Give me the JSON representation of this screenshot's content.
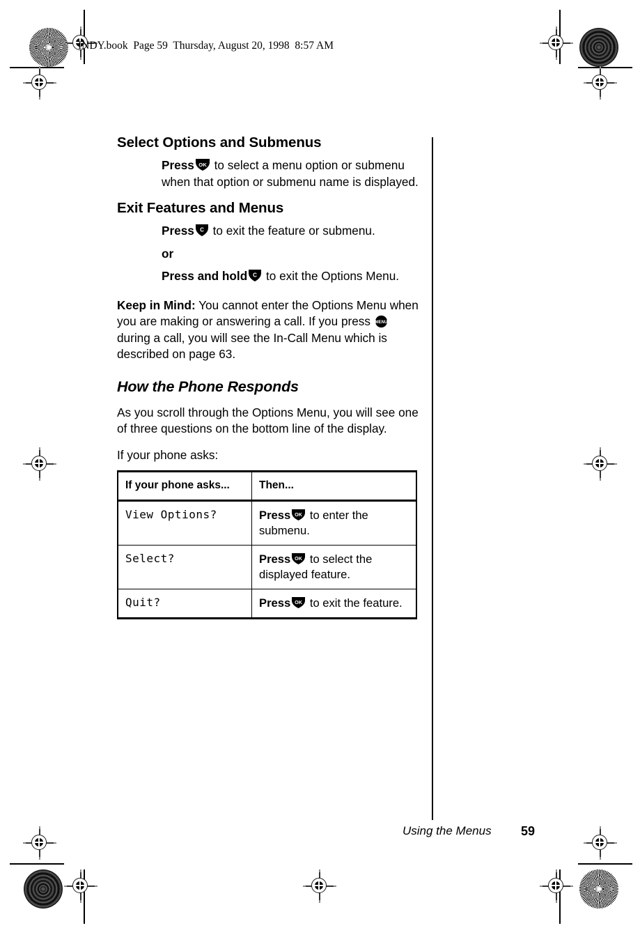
{
  "header": {
    "file_info": "INDY.book  Page 59  Thursday, August 20, 1998  8:57 AM"
  },
  "sections": [
    {
      "heading": "Select Options and Submenus",
      "paragraph_bold_lead": "Press",
      "paragraph_rest": " to select a menu option or submenu when that option or submenu name is displayed.",
      "key_icon": "ok-key-icon"
    },
    {
      "heading": "Exit Features and Menus",
      "line1_bold": "Press",
      "line1_rest": " to exit the feature or submenu.",
      "or_label": "or",
      "line2_bold": "Press and hold",
      "line2_rest": " to exit the Options Menu."
    }
  ],
  "keep_in_mind": {
    "lead": "Keep in Mind:",
    "text_part1": " You cannot enter the Options Menu when you are making or answering a call. If you press ",
    "text_part2": " during a call, you will see the In-Call Menu which is described on page 63."
  },
  "how_section": {
    "heading": "How the Phone Responds",
    "paragraph1": "As you scroll through the Options Menu, you will see one of three questions on the bottom line of the display.",
    "paragraph2": "If your phone asks:"
  },
  "table": {
    "headers": [
      "If your phone asks...",
      "Then..."
    ],
    "rows": [
      {
        "prompt": "View Options?",
        "action_bold": "Press",
        "action_rest": " to enter the submenu.",
        "key_icon": "ok-key-icon"
      },
      {
        "prompt": "Select?",
        "action_bold": "Press",
        "action_rest": " to select the displayed feature.",
        "key_icon": "ok-key-icon"
      },
      {
        "prompt": "Quit?",
        "action_bold": "Press",
        "action_rest": " to exit the feature.",
        "key_icon": "ok-key-icon"
      }
    ]
  },
  "footer": {
    "section_label": "Using the Menus",
    "page_number": "59"
  },
  "icons": {
    "ok_key_label": "OK",
    "clear_key_label": "C",
    "menu_key_label": "MENU"
  },
  "colors": {
    "ink": "#000000",
    "paper": "#ffffff",
    "registration_gray": "#8a8a8a"
  }
}
